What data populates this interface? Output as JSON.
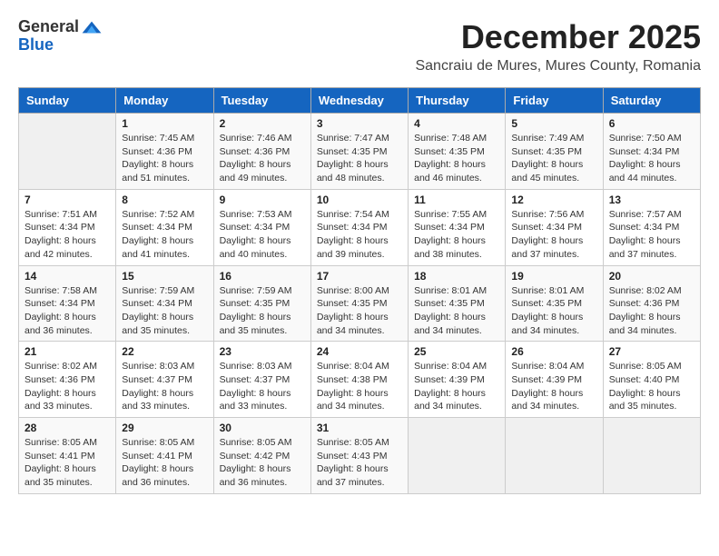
{
  "logo": {
    "line1": "General",
    "line2": "Blue"
  },
  "title": "December 2025",
  "subtitle": "Sancraiu de Mures, Mures County, Romania",
  "days_of_week": [
    "Sunday",
    "Monday",
    "Tuesday",
    "Wednesday",
    "Thursday",
    "Friday",
    "Saturday"
  ],
  "weeks": [
    [
      {
        "day": "",
        "sunrise": "",
        "sunset": "",
        "daylight": "",
        "empty": true
      },
      {
        "day": "1",
        "sunrise": "Sunrise: 7:45 AM",
        "sunset": "Sunset: 4:36 PM",
        "daylight": "Daylight: 8 hours and 51 minutes."
      },
      {
        "day": "2",
        "sunrise": "Sunrise: 7:46 AM",
        "sunset": "Sunset: 4:36 PM",
        "daylight": "Daylight: 8 hours and 49 minutes."
      },
      {
        "day": "3",
        "sunrise": "Sunrise: 7:47 AM",
        "sunset": "Sunset: 4:35 PM",
        "daylight": "Daylight: 8 hours and 48 minutes."
      },
      {
        "day": "4",
        "sunrise": "Sunrise: 7:48 AM",
        "sunset": "Sunset: 4:35 PM",
        "daylight": "Daylight: 8 hours and 46 minutes."
      },
      {
        "day": "5",
        "sunrise": "Sunrise: 7:49 AM",
        "sunset": "Sunset: 4:35 PM",
        "daylight": "Daylight: 8 hours and 45 minutes."
      },
      {
        "day": "6",
        "sunrise": "Sunrise: 7:50 AM",
        "sunset": "Sunset: 4:34 PM",
        "daylight": "Daylight: 8 hours and 44 minutes."
      }
    ],
    [
      {
        "day": "7",
        "sunrise": "Sunrise: 7:51 AM",
        "sunset": "Sunset: 4:34 PM",
        "daylight": "Daylight: 8 hours and 42 minutes."
      },
      {
        "day": "8",
        "sunrise": "Sunrise: 7:52 AM",
        "sunset": "Sunset: 4:34 PM",
        "daylight": "Daylight: 8 hours and 41 minutes."
      },
      {
        "day": "9",
        "sunrise": "Sunrise: 7:53 AM",
        "sunset": "Sunset: 4:34 PM",
        "daylight": "Daylight: 8 hours and 40 minutes."
      },
      {
        "day": "10",
        "sunrise": "Sunrise: 7:54 AM",
        "sunset": "Sunset: 4:34 PM",
        "daylight": "Daylight: 8 hours and 39 minutes."
      },
      {
        "day": "11",
        "sunrise": "Sunrise: 7:55 AM",
        "sunset": "Sunset: 4:34 PM",
        "daylight": "Daylight: 8 hours and 38 minutes."
      },
      {
        "day": "12",
        "sunrise": "Sunrise: 7:56 AM",
        "sunset": "Sunset: 4:34 PM",
        "daylight": "Daylight: 8 hours and 37 minutes."
      },
      {
        "day": "13",
        "sunrise": "Sunrise: 7:57 AM",
        "sunset": "Sunset: 4:34 PM",
        "daylight": "Daylight: 8 hours and 37 minutes."
      }
    ],
    [
      {
        "day": "14",
        "sunrise": "Sunrise: 7:58 AM",
        "sunset": "Sunset: 4:34 PM",
        "daylight": "Daylight: 8 hours and 36 minutes."
      },
      {
        "day": "15",
        "sunrise": "Sunrise: 7:59 AM",
        "sunset": "Sunset: 4:34 PM",
        "daylight": "Daylight: 8 hours and 35 minutes."
      },
      {
        "day": "16",
        "sunrise": "Sunrise: 7:59 AM",
        "sunset": "Sunset: 4:35 PM",
        "daylight": "Daylight: 8 hours and 35 minutes."
      },
      {
        "day": "17",
        "sunrise": "Sunrise: 8:00 AM",
        "sunset": "Sunset: 4:35 PM",
        "daylight": "Daylight: 8 hours and 34 minutes."
      },
      {
        "day": "18",
        "sunrise": "Sunrise: 8:01 AM",
        "sunset": "Sunset: 4:35 PM",
        "daylight": "Daylight: 8 hours and 34 minutes."
      },
      {
        "day": "19",
        "sunrise": "Sunrise: 8:01 AM",
        "sunset": "Sunset: 4:35 PM",
        "daylight": "Daylight: 8 hours and 34 minutes."
      },
      {
        "day": "20",
        "sunrise": "Sunrise: 8:02 AM",
        "sunset": "Sunset: 4:36 PM",
        "daylight": "Daylight: 8 hours and 34 minutes."
      }
    ],
    [
      {
        "day": "21",
        "sunrise": "Sunrise: 8:02 AM",
        "sunset": "Sunset: 4:36 PM",
        "daylight": "Daylight: 8 hours and 33 minutes."
      },
      {
        "day": "22",
        "sunrise": "Sunrise: 8:03 AM",
        "sunset": "Sunset: 4:37 PM",
        "daylight": "Daylight: 8 hours and 33 minutes."
      },
      {
        "day": "23",
        "sunrise": "Sunrise: 8:03 AM",
        "sunset": "Sunset: 4:37 PM",
        "daylight": "Daylight: 8 hours and 33 minutes."
      },
      {
        "day": "24",
        "sunrise": "Sunrise: 8:04 AM",
        "sunset": "Sunset: 4:38 PM",
        "daylight": "Daylight: 8 hours and 34 minutes."
      },
      {
        "day": "25",
        "sunrise": "Sunrise: 8:04 AM",
        "sunset": "Sunset: 4:39 PM",
        "daylight": "Daylight: 8 hours and 34 minutes."
      },
      {
        "day": "26",
        "sunrise": "Sunrise: 8:04 AM",
        "sunset": "Sunset: 4:39 PM",
        "daylight": "Daylight: 8 hours and 34 minutes."
      },
      {
        "day": "27",
        "sunrise": "Sunrise: 8:05 AM",
        "sunset": "Sunset: 4:40 PM",
        "daylight": "Daylight: 8 hours and 35 minutes."
      }
    ],
    [
      {
        "day": "28",
        "sunrise": "Sunrise: 8:05 AM",
        "sunset": "Sunset: 4:41 PM",
        "daylight": "Daylight: 8 hours and 35 minutes."
      },
      {
        "day": "29",
        "sunrise": "Sunrise: 8:05 AM",
        "sunset": "Sunset: 4:41 PM",
        "daylight": "Daylight: 8 hours and 36 minutes."
      },
      {
        "day": "30",
        "sunrise": "Sunrise: 8:05 AM",
        "sunset": "Sunset: 4:42 PM",
        "daylight": "Daylight: 8 hours and 36 minutes."
      },
      {
        "day": "31",
        "sunrise": "Sunrise: 8:05 AM",
        "sunset": "Sunset: 4:43 PM",
        "daylight": "Daylight: 8 hours and 37 minutes."
      },
      {
        "day": "",
        "sunrise": "",
        "sunset": "",
        "daylight": "",
        "empty": true
      },
      {
        "day": "",
        "sunrise": "",
        "sunset": "",
        "daylight": "",
        "empty": true
      },
      {
        "day": "",
        "sunrise": "",
        "sunset": "",
        "daylight": "",
        "empty": true
      }
    ]
  ]
}
